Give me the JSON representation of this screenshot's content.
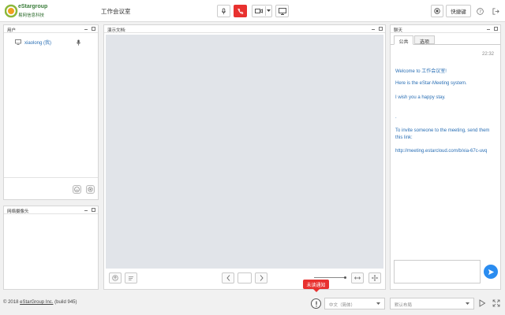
{
  "header": {
    "logo_text": "eStargroup",
    "logo_subtitle": "易网信息科技",
    "room_title": "工作会议室",
    "shortcut_label": "快捷键"
  },
  "users_panel": {
    "title": "用户",
    "users": [
      {
        "name": "xiaolong (我)"
      }
    ]
  },
  "camera_panel": {
    "title": "网络摄像头"
  },
  "presentation_panel": {
    "title": "演示文档:"
  },
  "chat_panel": {
    "title": "聊天",
    "tabs": [
      {
        "label": "公共",
        "active": true
      },
      {
        "label": "选项",
        "active": false
      }
    ],
    "time": "22:32",
    "messages": [
      "Welcome to 工作会议室!",
      "Here is the eStar-Meeting system.",
      "I wish you a happy stay.",
      ".",
      "To invite someone to the meeting, send them",
      "this link:",
      "http://meeting.estarcloud.com/b/xia-67c-uvq"
    ]
  },
  "footer": {
    "copyright_prefix": "© 2018 ",
    "copyright_link": "eStarGroup Inc.",
    "copyright_suffix": " (build 945)",
    "unread_tooltip": "未读通知",
    "language_select": "中文（简体）",
    "layout_select": "默认布局"
  },
  "colors": {
    "accent": "#2a8cf0",
    "hangup": "#e8312f",
    "tooltip": "#e8312f",
    "link": "#2a6fb5"
  }
}
